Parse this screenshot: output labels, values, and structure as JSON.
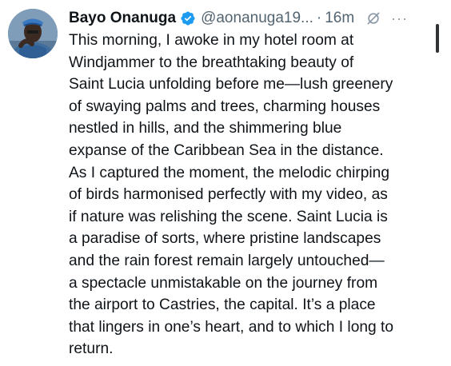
{
  "author": {
    "name": "Bayo Onanuga",
    "handle": "@aonanuga19...",
    "verified": true
  },
  "meta": {
    "separator": "·",
    "time": "16m",
    "more_label": "···"
  },
  "icons": {
    "avatar": "profile-photo",
    "verified": "verified-badge-icon",
    "grok": "grok-icon",
    "more": "more-options-icon"
  },
  "colors": {
    "verified_badge": "#1d9bf0",
    "text": "#0f1419",
    "secondary_text": "#536471"
  },
  "tweet": {
    "lines": [
      "This morning, I awoke in my hotel room at",
      "Windjammer to the breathtaking beauty of",
      "Saint Lucia unfolding before me—lush greenery",
      "of swaying palms and trees, charming houses",
      "nestled in hills, and the shimmering blue",
      "expanse of the Caribbean Sea in the distance.",
      "As I captured the moment, the melodic chirping",
      "of birds harmonised perfectly with my video, as",
      "if nature was relishing the scene. Saint Lucia is",
      "a paradise of sorts, where pristine landscapes",
      "and the rain forest  remain largely untouched—",
      "a spectacle unmistakable on the journey from",
      "the airport to Castries, the capital. It’s a place",
      "that lingers in one’s heart, and to which I long to",
      "return."
    ]
  }
}
